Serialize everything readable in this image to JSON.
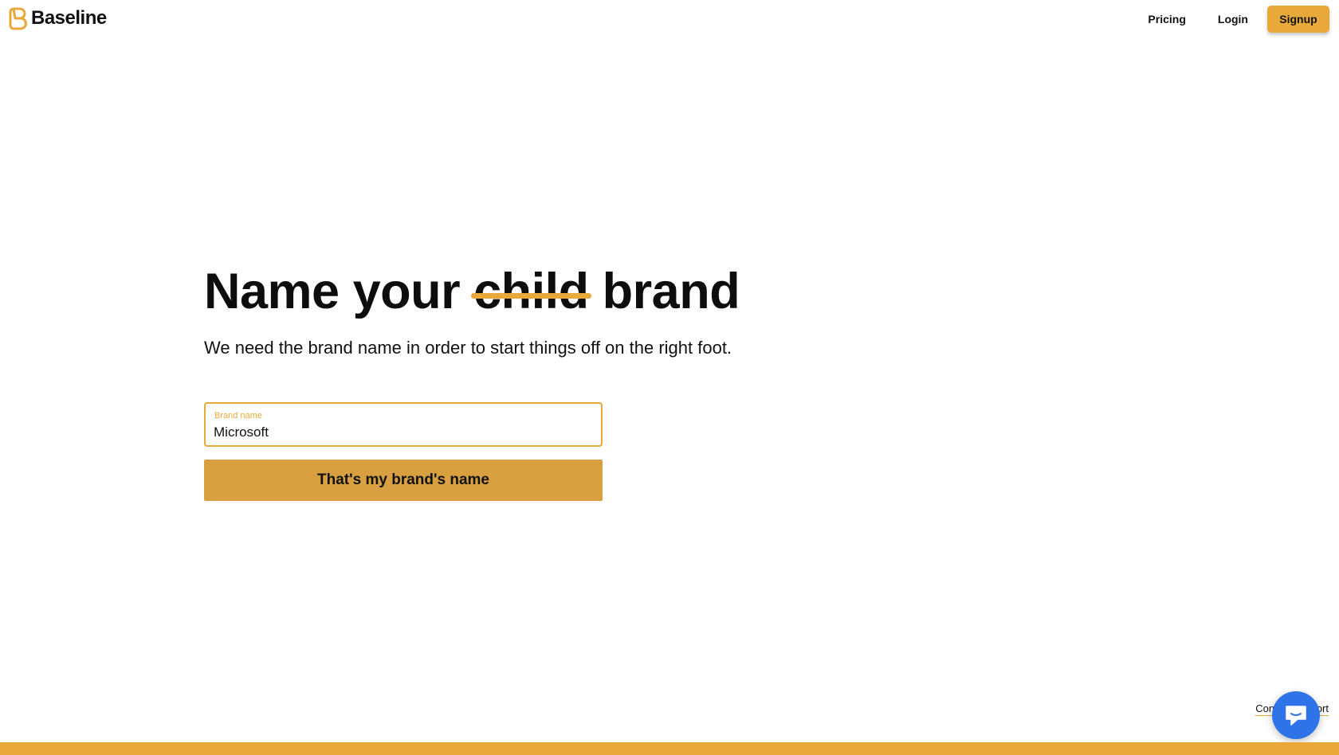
{
  "header": {
    "logo_text": "Baseline",
    "nav": {
      "pricing": "Pricing",
      "login": "Login",
      "signup": "Signup"
    }
  },
  "hero": {
    "headline_before": "Name your",
    "headline_struck": "child",
    "headline_after": "brand",
    "subtitle": "We need the brand name in order to start things off on the right foot."
  },
  "form": {
    "field_label": "Brand name",
    "field_value": "Microsoft",
    "submit_label": "That's my brand's name"
  },
  "footer": {
    "contact_text": "Contact support"
  },
  "colors": {
    "accent": "#e9a93a",
    "button": "#d9a042",
    "chat": "#2f73e8"
  },
  "icons": {
    "logo": "baseline-logo-icon",
    "chat": "chat-bubble-icon"
  }
}
